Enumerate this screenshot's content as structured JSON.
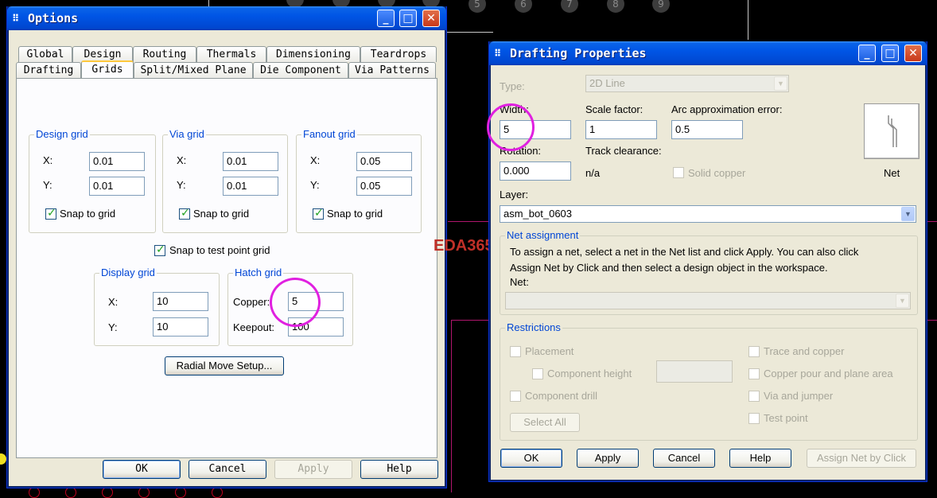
{
  "canvas": {
    "pin_numbers": [
      "5",
      "6",
      "7",
      "8",
      "9"
    ],
    "watermark": "EDA365",
    "colors": {
      "background": "#000000",
      "accent_markup": "#e020e0"
    }
  },
  "options_dialog": {
    "title": "Options",
    "tabs_row1": [
      "Global",
      "Design",
      "Routing",
      "Thermals",
      "Dimensioning",
      "Teardrops"
    ],
    "tabs_row2": [
      "Drafting",
      "Grids",
      "Split/Mixed Plane",
      "Die Component",
      "Via Patterns"
    ],
    "active_tab": "Grids",
    "design_grid": {
      "label": "Design grid",
      "x_label": "X:",
      "x": "0.01",
      "y_label": "Y:",
      "y": "0.01",
      "snap_label": "Snap to grid",
      "snap_checked": true
    },
    "via_grid": {
      "label": "Via grid",
      "x_label": "X:",
      "x": "0.01",
      "y_label": "Y:",
      "y": "0.01",
      "snap_label": "Snap to grid",
      "snap_checked": true
    },
    "fanout_grid": {
      "label": "Fanout grid",
      "x_label": "X:",
      "x": "0.05",
      "y_label": "Y:",
      "y": "0.05",
      "snap_label": "Snap to grid",
      "snap_checked": true
    },
    "snap_test_point": {
      "label": "Snap to test point grid",
      "checked": true
    },
    "display_grid": {
      "label": "Display grid",
      "x_label": "X:",
      "x": "10",
      "y_label": "Y:",
      "y": "10"
    },
    "hatch_grid": {
      "label": "Hatch grid",
      "copper_label": "Copper:",
      "copper": "5",
      "keepout_label": "Keepout:",
      "keepout": "100"
    },
    "radial_move_button": "Radial Move Setup...",
    "buttons": {
      "ok": "OK",
      "cancel": "Cancel",
      "apply": "Apply",
      "help": "Help"
    }
  },
  "drafting_dialog": {
    "title": "Drafting Properties",
    "type_label": "Type:",
    "type_value": "2D Line",
    "width_label": "Width:",
    "width_value": "5",
    "scale_label": "Scale factor:",
    "scale_value": "1",
    "arc_label": "Arc approximation error:",
    "arc_value": "0.5",
    "rotation_label": "Rotation:",
    "rotation_value": "0.000",
    "track_clearance_label": "Track clearance:",
    "track_clearance_value": "n/a",
    "solid_copper_label": "Solid copper",
    "net_label_caption": "Net",
    "layer_label": "Layer:",
    "layer_value": "asm_bot_0603",
    "net_assignment": {
      "label": "Net assignment",
      "line1": "To assign a net, select a net in the Net list and click Apply. You can also click",
      "line2": "Assign Net by Click and then select a design object in the workspace.",
      "net_label": "Net:",
      "net_value": ""
    },
    "restrictions": {
      "label": "Restrictions",
      "placement": "Placement",
      "component_height": "Component height",
      "component_drill": "Component drill",
      "trace_copper": "Trace and copper",
      "copper_pour": "Copper pour and plane area",
      "via_jumper": "Via and jumper",
      "test_point": "Test point",
      "select_all": "Select All"
    },
    "buttons": {
      "ok": "OK",
      "apply": "Apply",
      "cancel": "Cancel",
      "help": "Help",
      "assign_net": "Assign Net by Click"
    }
  }
}
